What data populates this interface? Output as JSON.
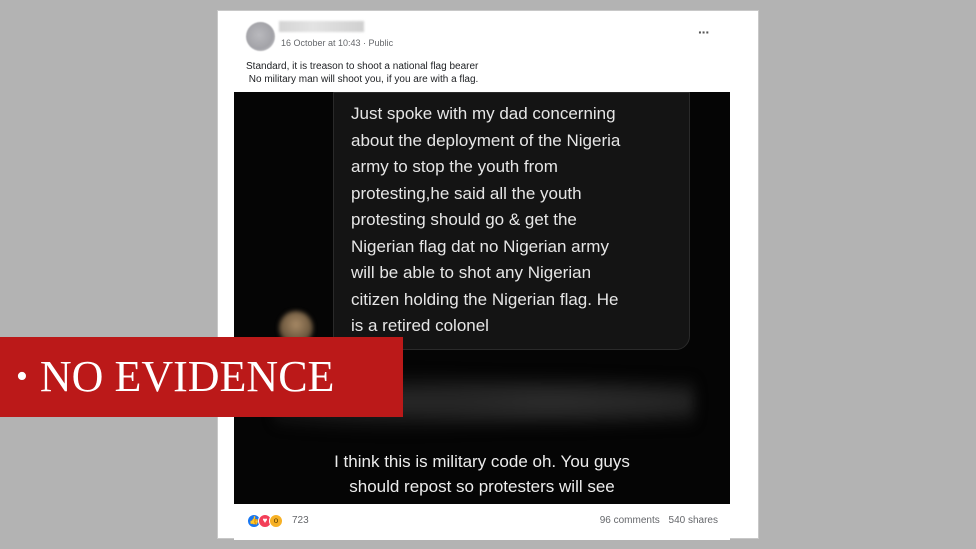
{
  "post": {
    "timestamp": "16 October at 10:43 · Public",
    "more_label": "···",
    "caption_lines": [
      "Standard, it is treason to shoot a national flag bearer",
      " No military man will shoot you, if you are with a flag."
    ]
  },
  "image": {
    "message_lines": [
      "Just spoke with my dad concerning",
      "about the deployment of the Nigeria",
      "army to stop the youth from",
      "protesting,he said all the youth",
      "protesting should go & get the",
      "Nigerian flag dat no Nigerian army",
      "will be able to shot any Nigerian",
      "citizen holding the Nigerian flag. He",
      "is a retired colonel"
    ],
    "bottom_lines": [
      "I think this is military code oh. You guys",
      "should repost so protesters will see"
    ]
  },
  "footer": {
    "reaction_icons": [
      "like-icon",
      "love-icon",
      "wow-icon"
    ],
    "reaction_count": "723",
    "comments": "96 comments",
    "shares": "540 shares"
  },
  "label": {
    "bullet": "•",
    "text": "NO EVIDENCE",
    "color": "#bb1919"
  }
}
